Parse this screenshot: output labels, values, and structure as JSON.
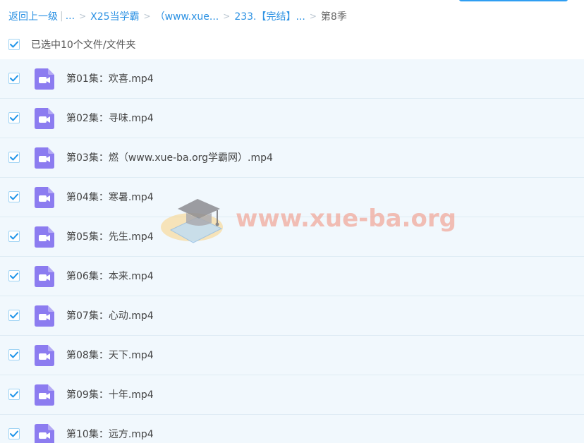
{
  "breadcrumb": {
    "back": "返回上一级",
    "bar": "|",
    "ellipsis": "...",
    "items": [
      "X25当学霸",
      "（www.xue...",
      "233.【完结】..."
    ],
    "current": "第8季",
    "sep": ">"
  },
  "selection": {
    "label": "已选中10个文件/文件夹",
    "checked": true
  },
  "files": [
    {
      "name": "第01集：欢喜.mp4",
      "checked": true
    },
    {
      "name": "第02集：寻味.mp4",
      "checked": true
    },
    {
      "name": "第03集：燃（www.xue-ba.org学霸网）.mp4",
      "checked": true
    },
    {
      "name": "第04集：寒暑.mp4",
      "checked": true
    },
    {
      "name": "第05集：先生.mp4",
      "checked": true
    },
    {
      "name": "第06集：本来.mp4",
      "checked": true
    },
    {
      "name": "第07集：心动.mp4",
      "checked": true
    },
    {
      "name": "第08集：天下.mp4",
      "checked": true
    },
    {
      "name": "第09集：十年.mp4",
      "checked": true
    },
    {
      "name": "第10集：远方.mp4",
      "checked": true
    }
  ],
  "watermark": {
    "text": "www.xue-ba.org",
    "icon": "graduation-cap-icon"
  },
  "colors": {
    "accent": "#2b91e3",
    "video_icon": "#8c7cf0",
    "row_bg": "#f1f8fd",
    "check": "#1e94e9"
  }
}
